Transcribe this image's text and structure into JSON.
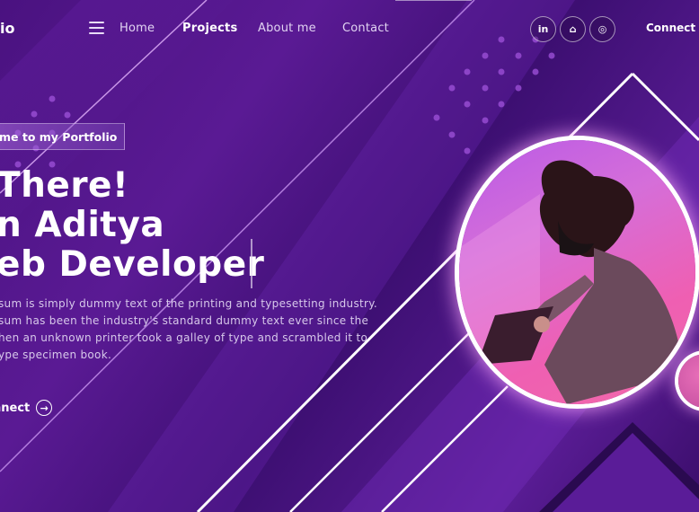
{
  "brand": {
    "logo_text": "io"
  },
  "nav": {
    "links": [
      {
        "label": "Home"
      },
      {
        "label": "Projects"
      },
      {
        "label": "About me"
      },
      {
        "label": "Contact"
      }
    ],
    "social": [
      {
        "icon": "linkedin-icon",
        "glyph": "in"
      },
      {
        "icon": "github-icon",
        "glyph": "⌂"
      },
      {
        "icon": "instagram-icon",
        "glyph": "◎"
      }
    ],
    "connect_label": "Connect W"
  },
  "hero": {
    "tagline": "me to my Portfolio",
    "line1": "There!",
    "line2": "n Aditya",
    "line3": "eb Developer",
    "paragraph": [
      "sum is simply dummy text of the printing and typesetting industry.",
      "sum has been the industry's standard dummy text ever since the",
      "hen an unknown printer took a galley of type and scrambled it to",
      "ype specimen book."
    ],
    "cta_label": "nnect",
    "cta_icon": "arrow-right-circle-icon"
  },
  "colors": {
    "accent": "#7b2fc9",
    "background": "#4a1280",
    "glow": "#f3a4ff"
  }
}
